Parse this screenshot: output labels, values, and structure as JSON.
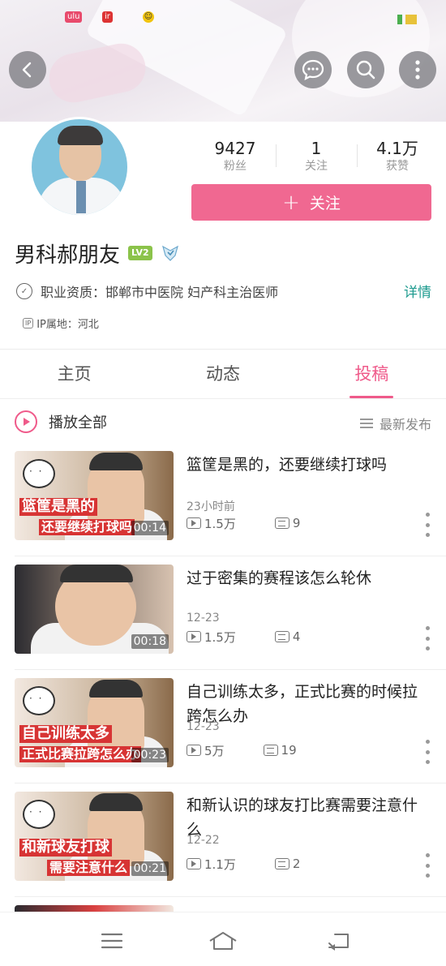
{
  "header": {
    "back_icon": "chevron-left-icon",
    "message_icon": "chat-bubble-icon",
    "search_icon": "search-icon",
    "more_icon": "more-vertical-icon"
  },
  "profile": {
    "stats": [
      {
        "value": "9427",
        "label": "粉丝"
      },
      {
        "value": "1",
        "label": "关注"
      },
      {
        "value": "4.1万",
        "label": "获赞"
      }
    ],
    "follow_button": "关注",
    "name": "男科郝朋友",
    "level": "LV2",
    "qualification": "职业资质：邯郸市中医院 妇产科主治医师",
    "detail_link": "详情",
    "ip_location": "IP属地：河北",
    "ip_icon_text": "IP"
  },
  "tabs": [
    {
      "label": "主页",
      "active": false
    },
    {
      "label": "动态",
      "active": false
    },
    {
      "label": "投稿",
      "active": true
    }
  ],
  "toolbar": {
    "play_all": "播放全部",
    "sort": "最新发布"
  },
  "videos": [
    {
      "title": "篮筐是黑的，还要继续打球吗",
      "date": "23小时前",
      "plays": "1.5万",
      "comments": "9",
      "duration": "00:14",
      "caption1": "篮筐是黑的",
      "caption2": "还要继续打球吗"
    },
    {
      "title": "过于密集的赛程该怎么轮休",
      "date": "12-23",
      "plays": "1.5万",
      "comments": "4",
      "duration": "00:18",
      "caption1": "",
      "caption2": ""
    },
    {
      "title": "自己训练太多，正式比赛的时候拉跨怎么办",
      "date": "12-23",
      "plays": "5万",
      "comments": "19",
      "duration": "00:23",
      "caption1": "自己训练太多",
      "caption2": "正式比赛拉跨怎么办"
    },
    {
      "title": "和新认识的球友打比赛需要注意什么",
      "date": "12-22",
      "plays": "1.1万",
      "comments": "2",
      "duration": "00:21",
      "caption1": "和新球友打球",
      "caption2": "需要注意什么"
    }
  ],
  "colors": {
    "accent": "#ef5a8a",
    "follow_button": "#f06891",
    "link": "#1e9b8f",
    "level_badge": "#8bc34a"
  }
}
